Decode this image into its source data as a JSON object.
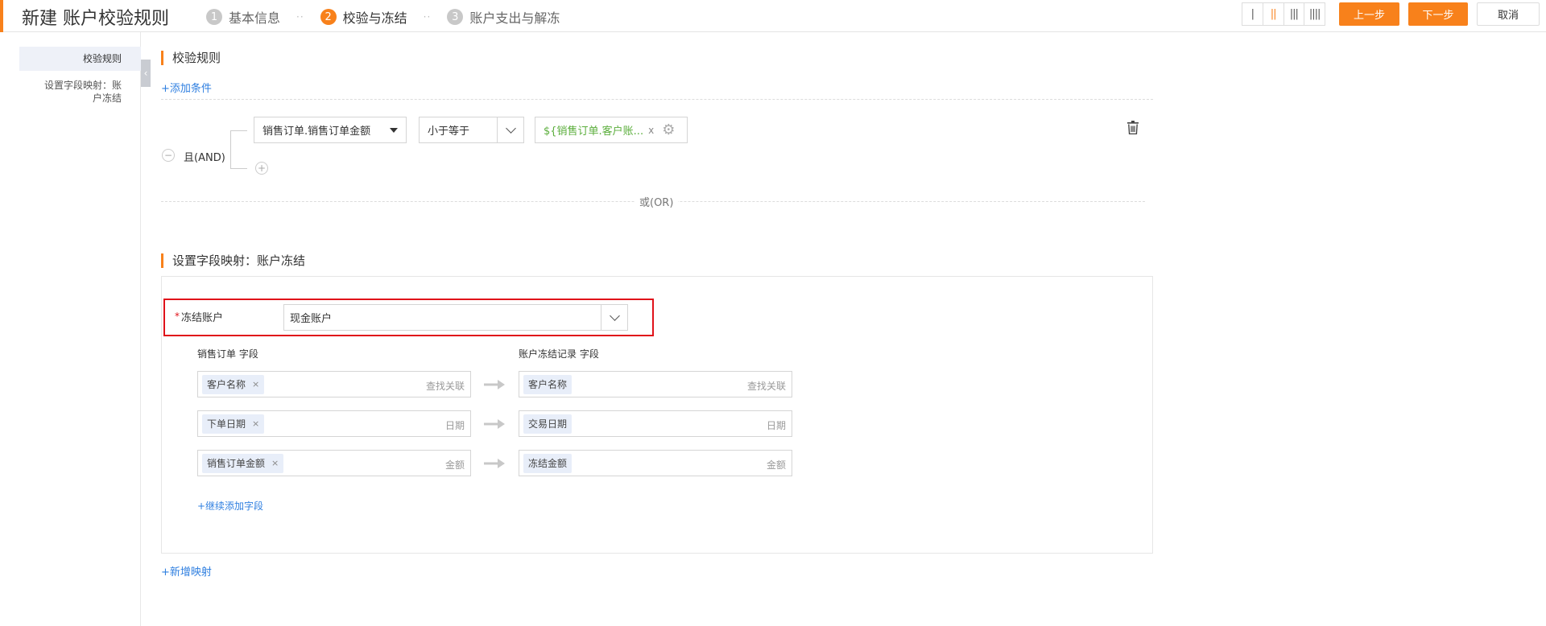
{
  "header": {
    "title": "新建 账户校验规则",
    "steps": [
      {
        "num": "1",
        "label": "基本信息"
      },
      {
        "num": "2",
        "label": "校验与冻结"
      },
      {
        "num": "3",
        "label": "账户支出与解冻"
      }
    ],
    "step_separator": "··",
    "layout_toggle": [
      "|",
      "||",
      "|||",
      "||||"
    ],
    "prev_label": "上一步",
    "next_label": "下一步",
    "cancel_label": "取消",
    "accent_color": "#f8811b"
  },
  "sidebar": {
    "items": [
      {
        "label": "校验规则"
      },
      {
        "label": "设置字段映射：账户冻结"
      }
    ]
  },
  "rules_section": {
    "title": "校验规则",
    "add_condition": "+添加条件",
    "logic_label": "且(AND)",
    "condition": {
      "field": "销售订单.销售订单金额",
      "operator": "小于等于",
      "value": "${销售订单.客户账..."
    },
    "or_label": "或(OR)"
  },
  "mapping_section": {
    "title": "设置字段映射：账户冻结",
    "freeze_account_label": "冻结账户",
    "freeze_account_value": "现金账户",
    "left_header": "销售订单 字段",
    "right_header": "账户冻结记录 字段",
    "rows": [
      {
        "left": "客户名称",
        "left_type": "查找关联",
        "right": "客户名称",
        "right_type": "查找关联"
      },
      {
        "left": "下单日期",
        "left_type": "日期",
        "right": "交易日期",
        "right_type": "日期"
      },
      {
        "left": "销售订单金额",
        "left_type": "金额",
        "right": "冻结金额",
        "right_type": "金额"
      }
    ],
    "add_field": "+继续添加字段",
    "add_mapping": "+新增映射"
  }
}
